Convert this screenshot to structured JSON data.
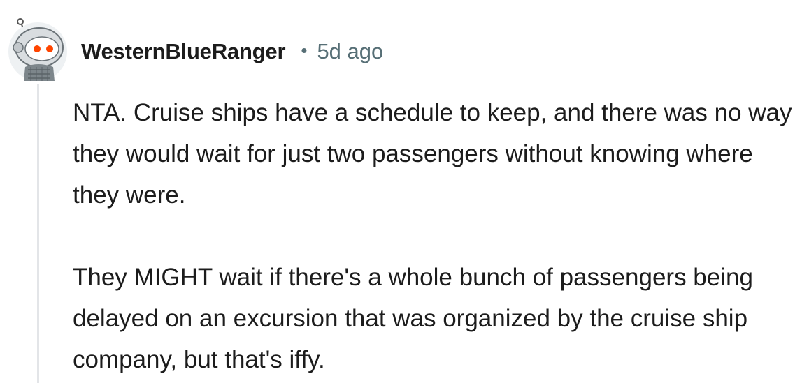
{
  "comment": {
    "author": "WesternBlueRanger",
    "separator": "•",
    "timestamp": "5d ago",
    "avatar_icon": "snoo-robot-avatar-icon",
    "paragraphs": [
      "NTA. Cruise ships have a schedule to keep, and there was no way they would wait for just two passengers without knowing where they were.",
      "They MIGHT wait if there's a whole bunch of passengers being delayed on an excursion that was organized by the cruise ship company, but that's iffy."
    ]
  }
}
